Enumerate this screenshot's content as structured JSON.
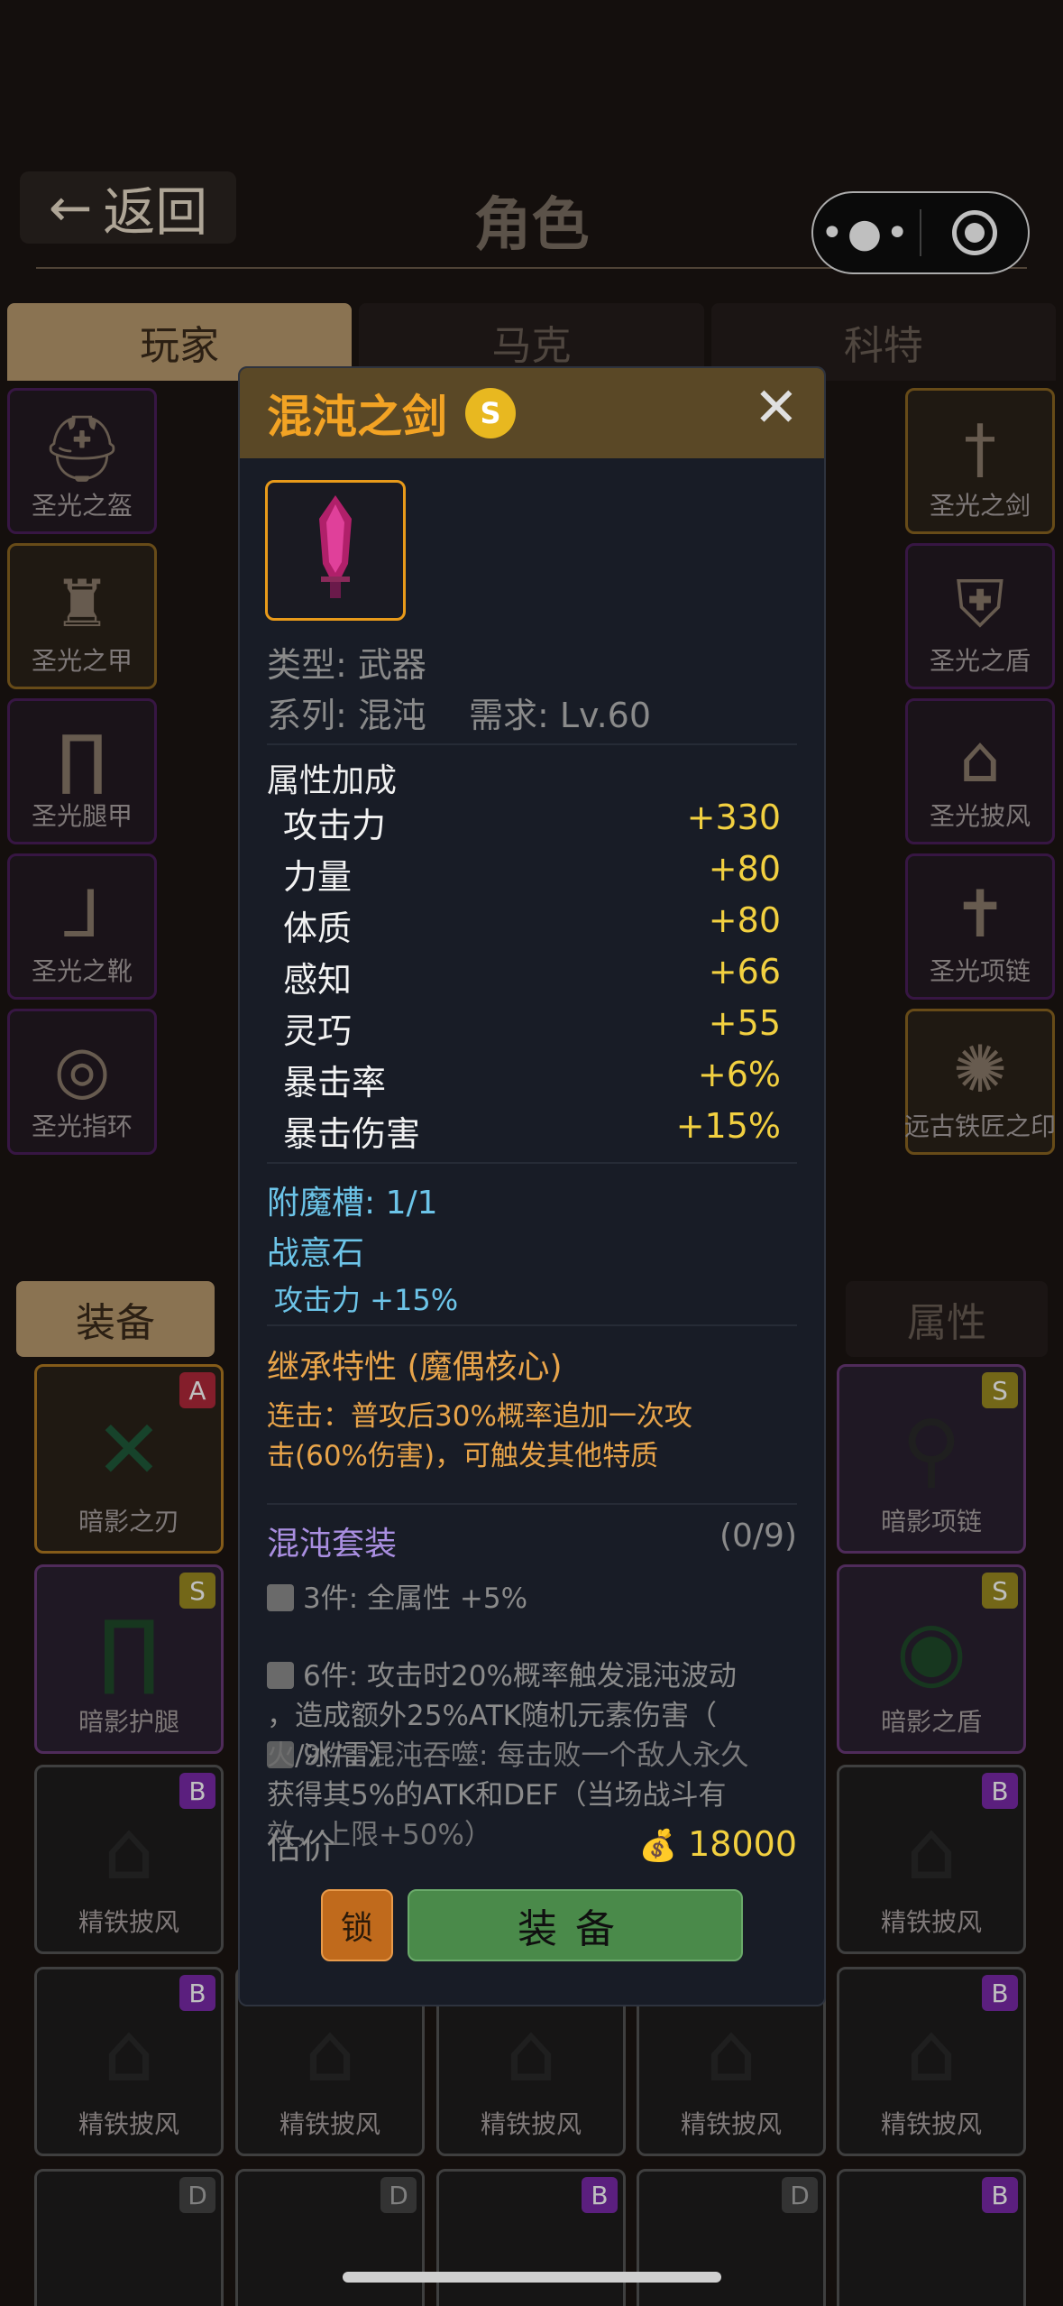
{
  "header": {
    "back_label": "返回",
    "title": "角色"
  },
  "tabs": [
    "玩家",
    "马克",
    "科特"
  ],
  "left_slots": [
    "圣光之盔",
    "圣光之甲",
    "圣光腿甲",
    "圣光之靴",
    "圣光指环"
  ],
  "right_slots": [
    "圣光之剑",
    "圣光之盾",
    "圣光披风",
    "圣光项链",
    "远古铁匠之印"
  ],
  "lower_tabs": {
    "equip": "装备",
    "attr": "属性"
  },
  "cards": {
    "r1": [
      {
        "label": "暗影之刃",
        "badge": "A"
      },
      {
        "label": "暗影项链",
        "badge": "S"
      }
    ],
    "r2": [
      {
        "label": "暗影护腿",
        "badge": "S"
      },
      {
        "label": "暗影之盾",
        "badge": "S"
      }
    ],
    "r3": [
      {
        "label": "精铁披风",
        "badge": "B"
      },
      {
        "label": "精铁披风",
        "badge": "B"
      }
    ],
    "r4": [
      {
        "label": "精铁披风",
        "badge": "B"
      },
      {
        "label": "精铁披风",
        "badge": ""
      },
      {
        "label": "精铁披风",
        "badge": ""
      },
      {
        "label": "精铁披风",
        "badge": ""
      },
      {
        "label": "精铁披风",
        "badge": "B"
      }
    ],
    "r5": [
      "D",
      "D",
      "B",
      "D",
      "B"
    ]
  },
  "modal": {
    "name": "混沌之剑",
    "rank": "S",
    "type_line": "类型: 武器",
    "series_line": "系列: 混沌",
    "req_line": "需求: Lv.60",
    "attr_title": "属性加成",
    "stats": [
      {
        "name": "攻击力",
        "value": "+330"
      },
      {
        "name": "力量",
        "value": "+80"
      },
      {
        "name": "体质",
        "value": "+80"
      },
      {
        "name": "感知",
        "value": "+66"
      },
      {
        "name": "灵巧",
        "value": "+55"
      },
      {
        "name": "暴击率",
        "value": "+6%"
      },
      {
        "name": "暴击伤害",
        "value": "+15%"
      }
    ],
    "enchant_slots": "附魔槽: 1/1",
    "enchant_stone": "战意石",
    "enchant_effect": "攻击力 +15%",
    "inherit_title": "继承特性 (魔偶核心)",
    "inherit_desc_1": "连击：普攻后30%概率追加一次攻",
    "inherit_desc_2": "击(60%伤害)，可触发其他特质",
    "set_title": "混沌套装",
    "set_count": "(0/9)",
    "set_3": "3件: 全属性 +5%",
    "set_6_1": "6件: 攻击时20%概率触发混沌波动",
    "set_6_2": "，造成额外25%ATK随机元素伤害（",
    "set_6_3": "火/冰/雷）",
    "set_9_1": "9件: 混沌吞噬: 每击败一个敌人永久",
    "set_9_2": "获得其5%的ATK和DEF（当场战斗有",
    "set_9_3": "效，上限+50%）",
    "price_label": "估价",
    "price_value": "18000",
    "lock_label": "锁",
    "equip_label": "装备"
  }
}
